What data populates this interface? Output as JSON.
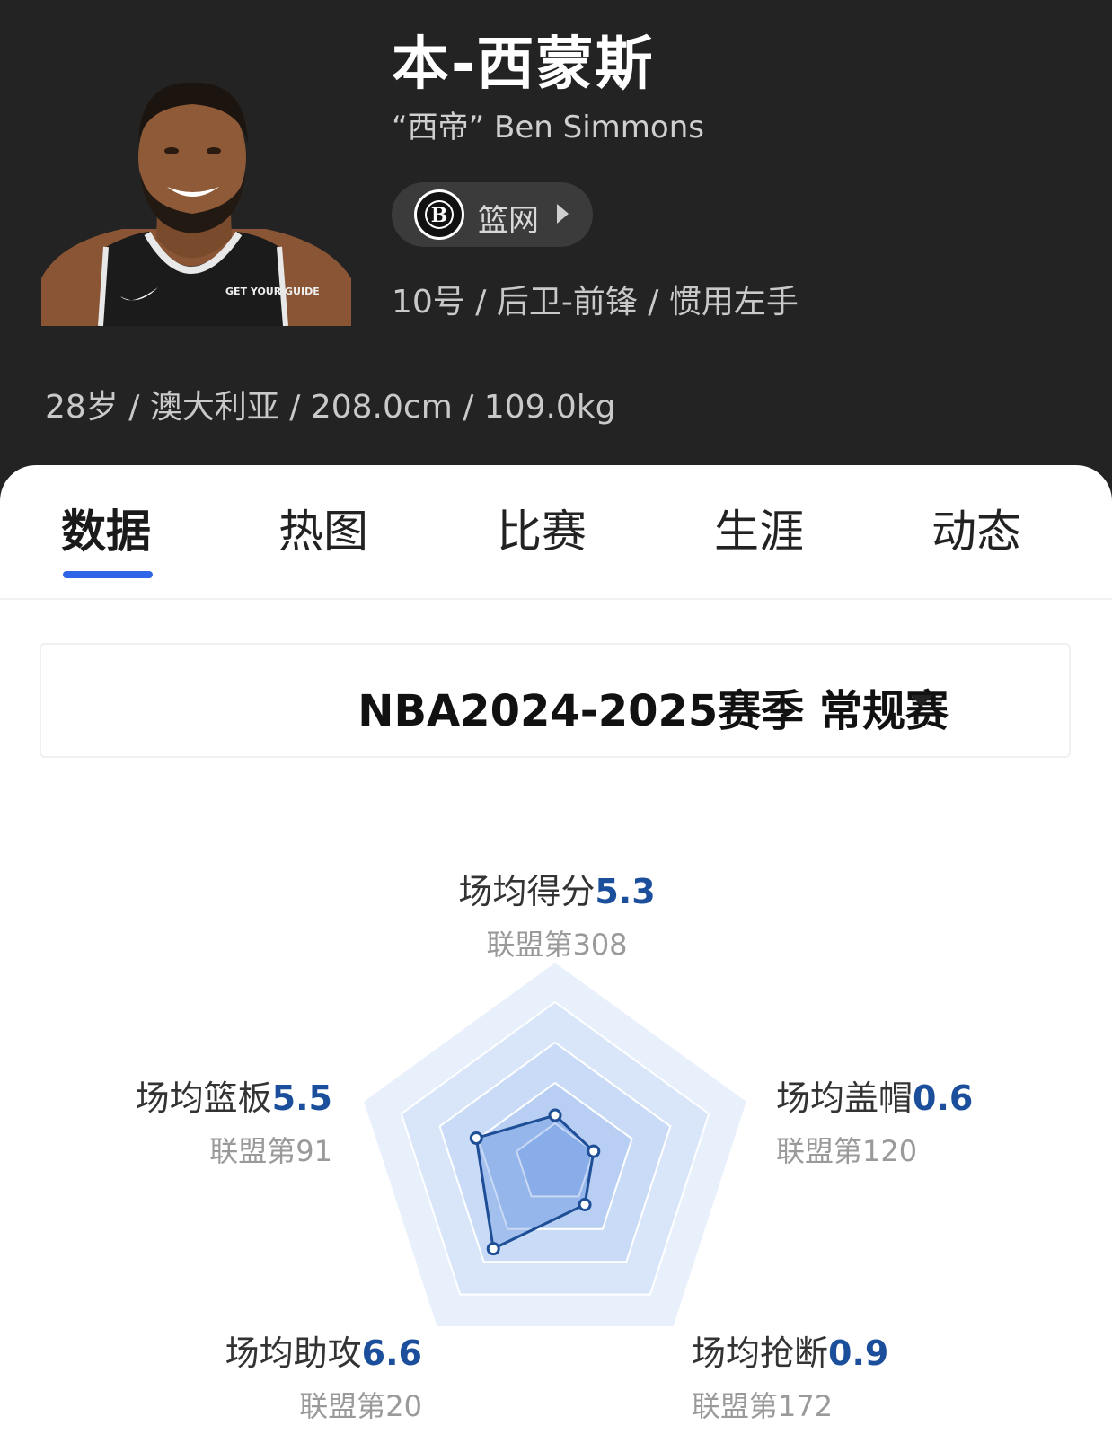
{
  "player": {
    "name": "本-西蒙斯",
    "subtitle": "“西帝” Ben Simmons",
    "team": "篮网",
    "meta": "10号 / 后卫-前锋 / 惯用左手",
    "info": "28岁 / 澳大利亚 / 208.0cm / 109.0kg",
    "jersey_sponsor": "GET YOUR GUIDE"
  },
  "tabs": [
    {
      "label": "数据",
      "active": true
    },
    {
      "label": "热图",
      "active": false
    },
    {
      "label": "比赛",
      "active": false
    },
    {
      "label": "生涯",
      "active": false
    },
    {
      "label": "动态",
      "active": false
    }
  ],
  "season": {
    "label": "NBA2024-2025赛季 常规赛"
  },
  "colors": {
    "header_bg": "#232323",
    "accent": "#2f66e8",
    "value": "#1b4f9c",
    "radar_line": "#1d4e96"
  },
  "chart_data": {
    "type": "radar",
    "axes": [
      {
        "label": "场均得分",
        "value": 5.3,
        "value_text": "5.3",
        "rank": "联盟第308",
        "score": 0.24
      },
      {
        "label": "场均盖帽",
        "value": 0.6,
        "value_text": "0.6",
        "rank": "联盟第120",
        "score": 0.2
      },
      {
        "label": "场均抢断",
        "value": 0.9,
        "value_text": "0.9",
        "rank": "联盟第172",
        "score": 0.25
      },
      {
        "label": "场均助攻",
        "value": 6.6,
        "value_text": "6.6",
        "rank": "联盟第20",
        "score": 0.52
      },
      {
        "label": "场均篮板",
        "value": 5.5,
        "value_text": "5.5",
        "rank": "联盟第91",
        "score": 0.41
      }
    ],
    "rings": 5
  }
}
